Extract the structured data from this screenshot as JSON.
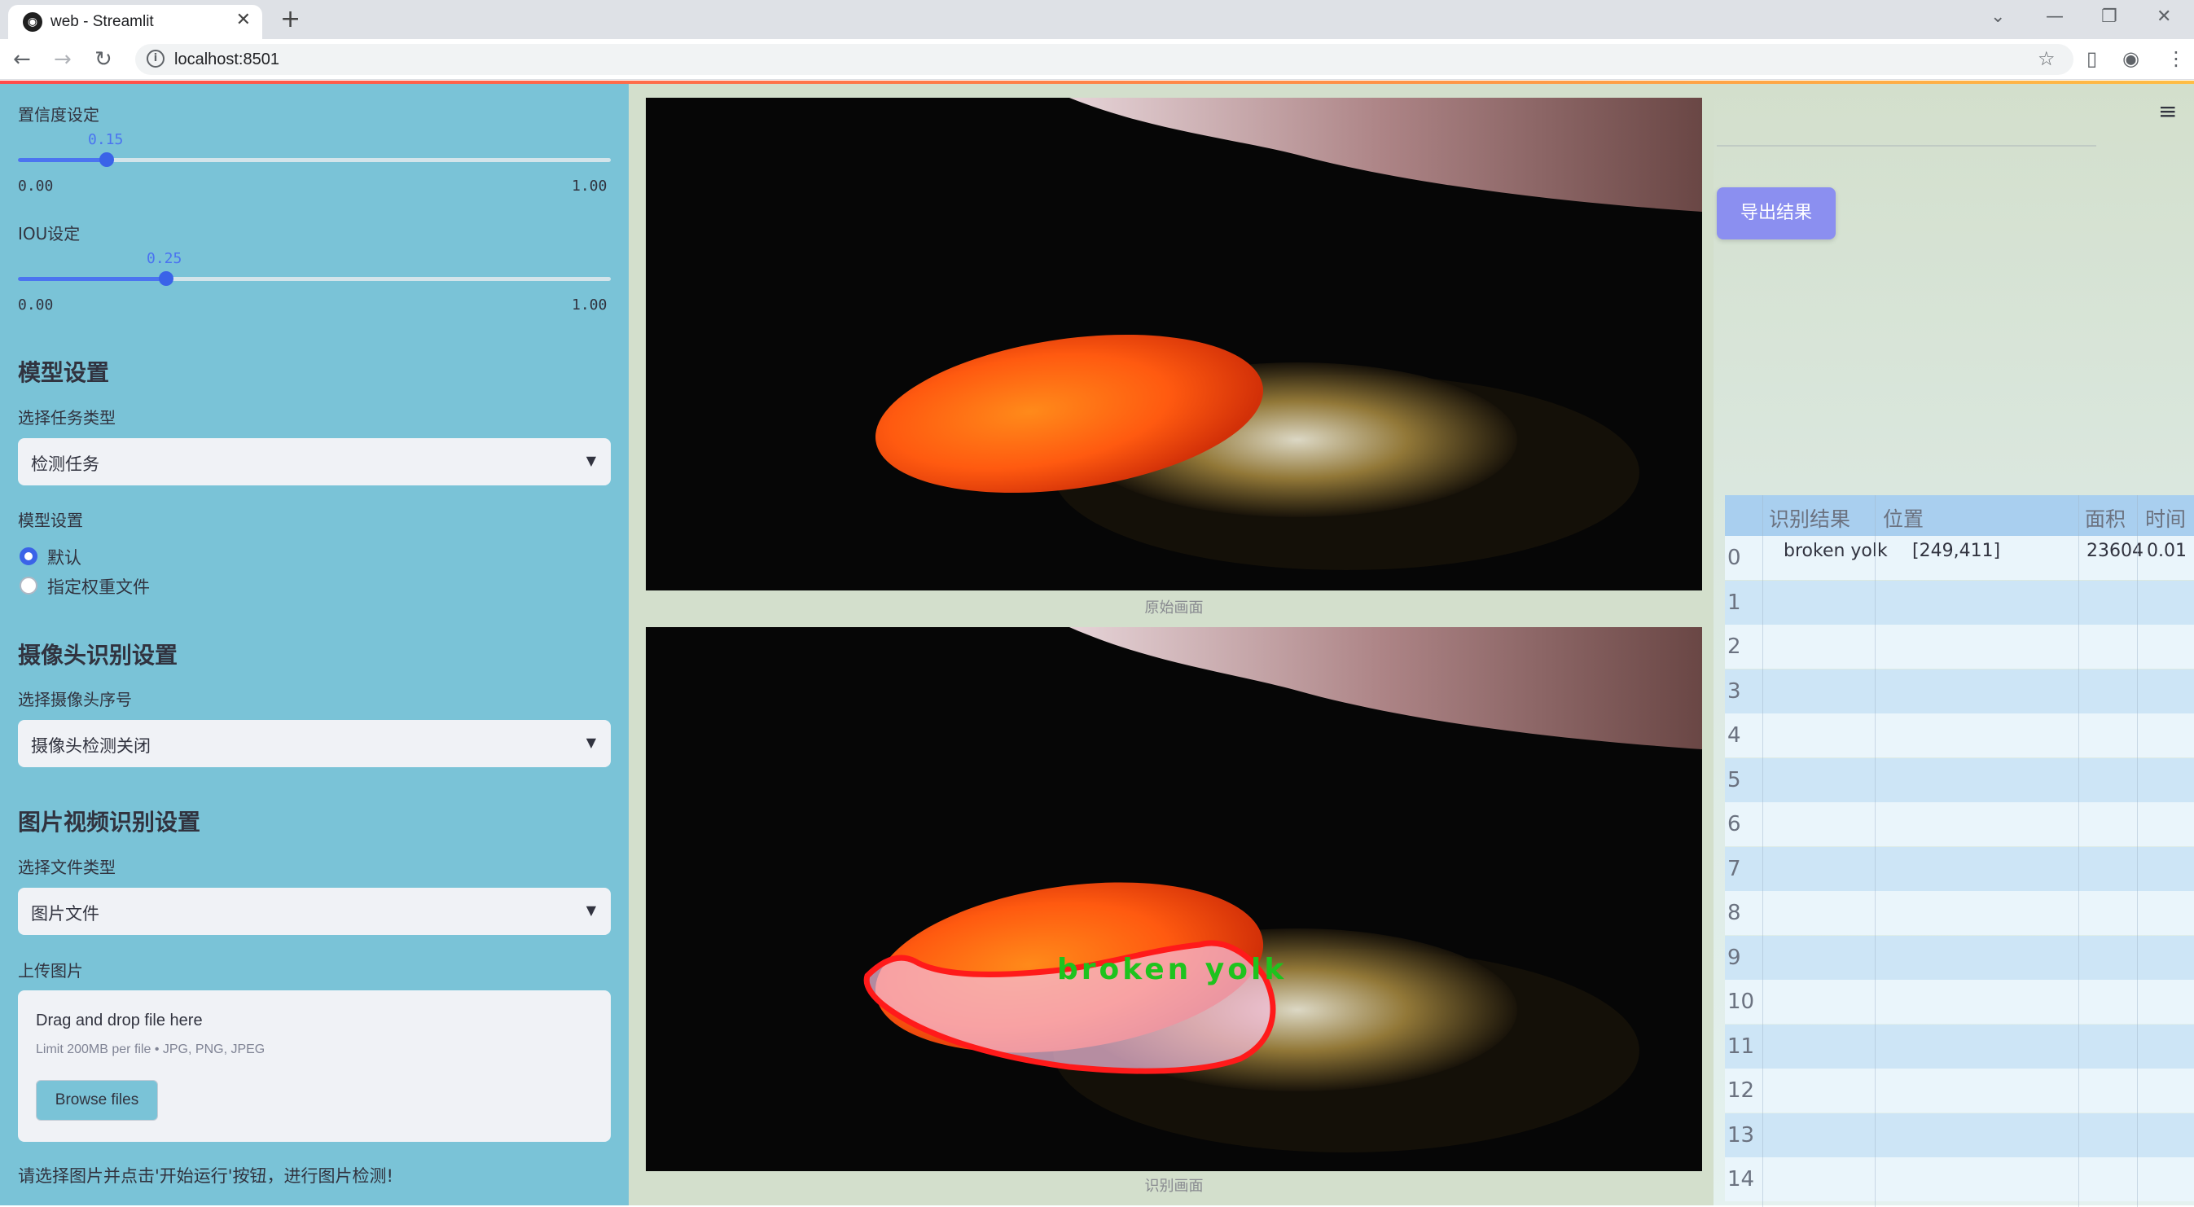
{
  "browser": {
    "tab_title": "web - Streamlit",
    "url": "localhost:8501"
  },
  "sidebar": {
    "confidence": {
      "label": "置信度设定",
      "value": 0.15,
      "value_text": "0.15",
      "min": "0.00",
      "max": "1.00"
    },
    "iou": {
      "label": "IOU设定",
      "value": 0.25,
      "value_text": "0.25",
      "min": "0.00",
      "max": "1.00"
    },
    "model_section": {
      "title": "模型设置",
      "task_label": "选择任务类型",
      "task_value": "检测任务",
      "model_label": "模型设置",
      "options": [
        "默认",
        "指定权重文件"
      ],
      "selected": 0
    },
    "camera_section": {
      "title": "摄像头识别设置",
      "camera_label": "选择摄像头序号",
      "camera_value": "摄像头检测关闭"
    },
    "media_section": {
      "title": "图片视频识别设置",
      "file_type_label": "选择文件类型",
      "file_type_value": "图片文件",
      "upload_label": "上传图片",
      "drop_text": "Drag and drop file here",
      "limit_text": "Limit 200MB per file • JPG, PNG, JPEG",
      "browse_label": "Browse files"
    },
    "hint": "请选择图片并点击'开始运行'按钮，进行图片检测!"
  },
  "main": {
    "original_caption": "原始画面",
    "result_caption": "识别画面",
    "detection_label": "broken  yolk",
    "export_label": "导出结果"
  },
  "table": {
    "headers": [
      "识别结果",
      "位置",
      "面积",
      "时间"
    ],
    "rows": [
      {
        "idx": "0",
        "result": "broken yolk",
        "pos": "[249,411]",
        "area": "23604",
        "time": "0.01"
      },
      {
        "idx": "1"
      },
      {
        "idx": "2"
      },
      {
        "idx": "3"
      },
      {
        "idx": "4"
      },
      {
        "idx": "5"
      },
      {
        "idx": "6"
      },
      {
        "idx": "7"
      },
      {
        "idx": "8"
      },
      {
        "idx": "9"
      },
      {
        "idx": "10"
      },
      {
        "idx": "11"
      },
      {
        "idx": "12"
      },
      {
        "idx": "13"
      },
      {
        "idx": "14"
      }
    ]
  },
  "colors": {
    "sidebar_bg": "#7ac3d7",
    "main_bg": "#d3dfcc",
    "accent": "#3a63e8",
    "export_button": "#8b8ff0",
    "detection_outline": "#ff1a1a",
    "detection_text": "#1ec31e"
  }
}
